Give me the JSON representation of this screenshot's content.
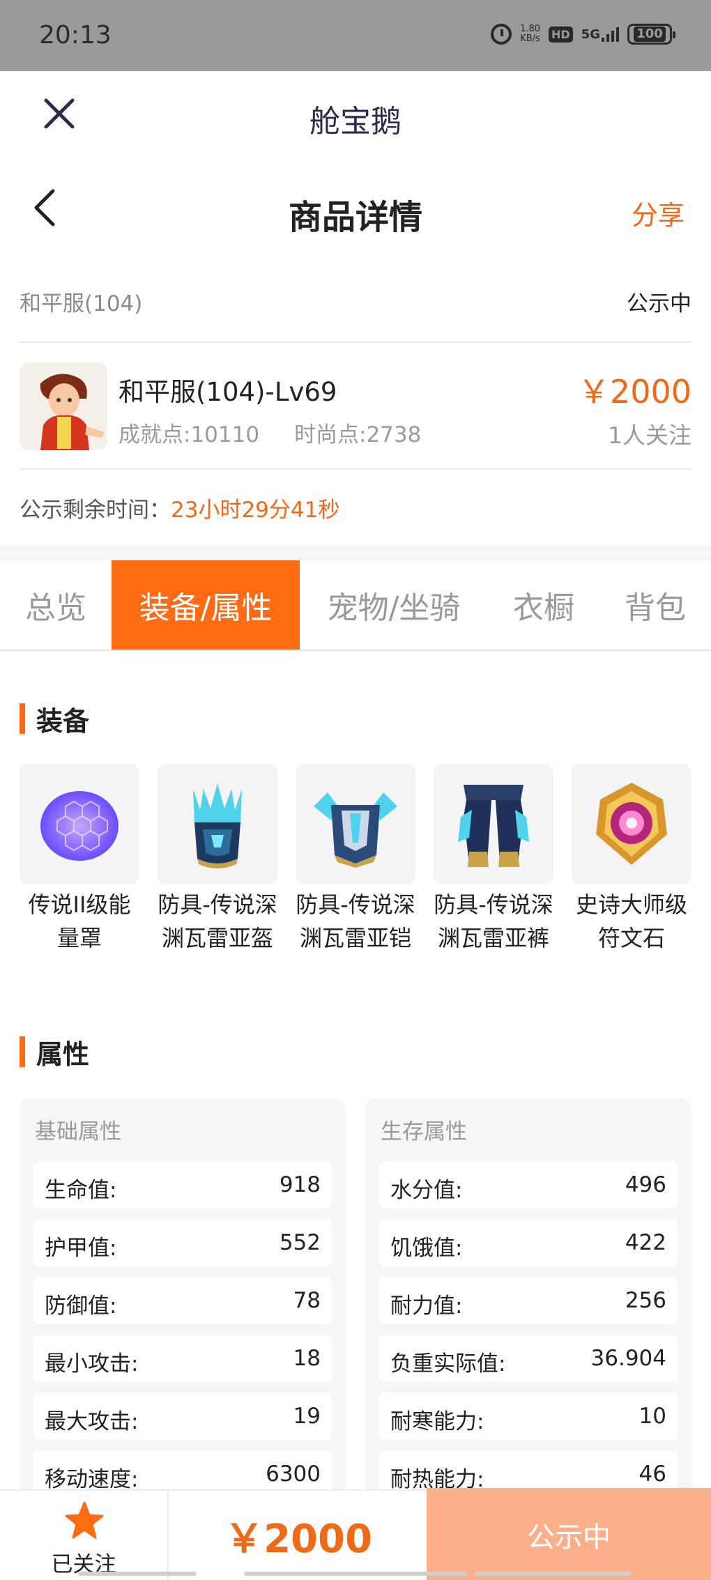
{
  "status_bar": {
    "time": "20:13",
    "speed_value": "1.80",
    "speed_unit": "KB/s",
    "hd": "HD",
    "network": "5G",
    "battery": "100"
  },
  "app": {
    "title": "舱宝鹅"
  },
  "page": {
    "title": "商品详情",
    "share": "分享"
  },
  "server": {
    "name": "和平服(104)",
    "status": "公示中"
  },
  "item": {
    "title": "和平服(104)-Lv69",
    "achievement": "成就点:10110",
    "fashion": "时尚点:2738",
    "price": "￥2000",
    "followers": "1人关注"
  },
  "countdown": {
    "label": "公示剩余时间：",
    "value": "23小时29分41秒"
  },
  "tabs": [
    {
      "label": "总览",
      "active": false
    },
    {
      "label": "装备/属性",
      "active": true
    },
    {
      "label": "宠物/坐骑",
      "active": false
    },
    {
      "label": "衣橱",
      "active": false
    },
    {
      "label": "背包",
      "active": false
    }
  ],
  "sections": {
    "equipment": "装备",
    "attributes": "属性"
  },
  "equipment": [
    {
      "name": "传说II级能量罩",
      "icon": "energy-shield-icon"
    },
    {
      "name": "防具-传说深渊瓦雷亚盔",
      "icon": "helmet-icon"
    },
    {
      "name": "防具-传说深渊瓦雷亚铠",
      "icon": "armor-icon"
    },
    {
      "name": "防具-传说深渊瓦雷亚裤",
      "icon": "pants-icon"
    },
    {
      "name": "史诗大师级符文石",
      "icon": "rune-stone-icon"
    }
  ],
  "attributes": {
    "basic": {
      "title": "基础属性",
      "rows": [
        {
          "key": "生命值:",
          "value": "918"
        },
        {
          "key": "护甲值:",
          "value": "552"
        },
        {
          "key": "防御值:",
          "value": "78"
        },
        {
          "key": "最小攻击:",
          "value": "18"
        },
        {
          "key": "最大攻击:",
          "value": "19"
        },
        {
          "key": "移动速度:",
          "value": "6300"
        }
      ]
    },
    "survival": {
      "title": "生存属性",
      "rows": [
        {
          "key": "水分值:",
          "value": "496"
        },
        {
          "key": "饥饿值:",
          "value": "422"
        },
        {
          "key": "耐力值:",
          "value": "256"
        },
        {
          "key": "负重实际值:",
          "value": "36.904"
        },
        {
          "key": "耐寒能力:",
          "value": "10"
        },
        {
          "key": "耐热能力:",
          "value": "46"
        }
      ]
    }
  },
  "bottom_bar": {
    "follow_label": "已关注",
    "price": "￥2000",
    "action": "公示中"
  },
  "colors": {
    "accent": "#ff6b12",
    "price": "#ee6a17",
    "action_button": "#fcb08a"
  }
}
